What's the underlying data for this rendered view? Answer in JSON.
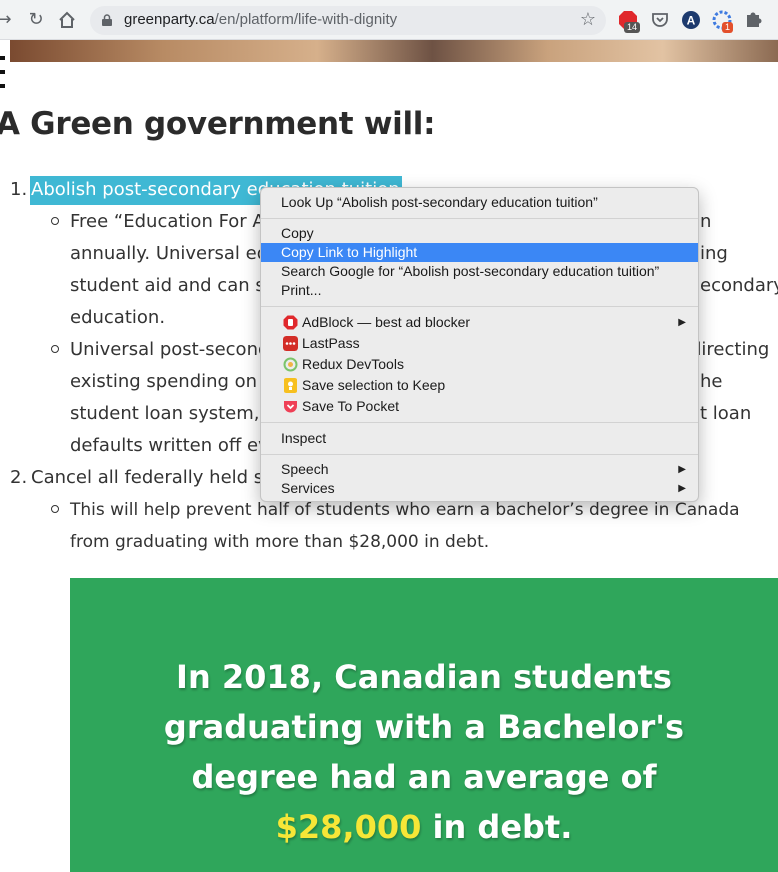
{
  "browser": {
    "url_domain": "greenparty.ca",
    "url_path": "/en/platform/life-with-dignity",
    "extension_badges": [
      "14",
      "1"
    ]
  },
  "page": {
    "heading": "A Green government will:",
    "items": [
      {
        "number": "1.",
        "title": "Abolish post-secondary education tuition",
        "sub": [
          {
            "lines": [
              "Free “Education For A",
              "annually. Universal ed",
              "student aid and can s",
              "education."
            ]
          },
          {
            "lines": [
              "Universal post-second",
              "existing spending on",
              "student loan system,",
              "defaults written off ev"
            ]
          }
        ],
        "right_lines": [
          "n",
          "ing",
          "econdary",
          "directing",
          "he",
          "t loan"
        ]
      },
      {
        "number": "2.",
        "title": "Cancel all federally held st",
        "sub": [
          {
            "lines": [
              "This will help prevent half of students who earn a bachelor’s degree in Canada",
              "from graduating with more than $28,000 in debt."
            ]
          }
        ]
      }
    ],
    "banner": {
      "line1": "In 2018, Canadian students",
      "line2": "graduating with a Bachelor's",
      "line3": "degree had an average of",
      "amount": "$28,000",
      "suffix": " in debt."
    }
  },
  "context_menu": {
    "look_up": "Look Up “Abolish post-secondary education tuition”",
    "copy": "Copy",
    "copy_link": "Copy Link to Highlight",
    "search_google": "Search Google for “Abolish post-secondary education tuition”",
    "print": "Print...",
    "adblock": "AdBlock — best ad blocker",
    "lastpass": "LastPass",
    "redux": "Redux DevTools",
    "keep": "Save selection to Keep",
    "pocket": "Save To Pocket",
    "inspect": "Inspect",
    "speech": "Speech",
    "services": "Services"
  },
  "colors": {
    "highlight": "#3fb8d4",
    "banner_green": "#2fa65b",
    "banner_accent": "#f6e637",
    "menu_selected": "#3b87f5"
  }
}
